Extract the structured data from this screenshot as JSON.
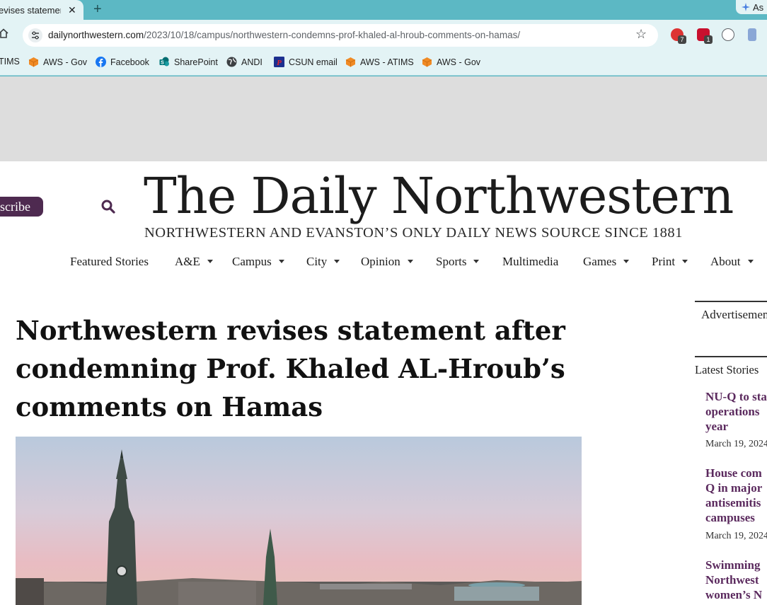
{
  "browser": {
    "tab_title": "evises statement",
    "new_tab_symbol": "+",
    "close_symbol": "✕",
    "ask_label": "As",
    "url_domain": "dailynorthwestern.com",
    "url_path": "/2023/10/18/campus/northwestern-condemns-prof-khaled-al-hroub-comments-on-hamas/",
    "extensions": [
      {
        "name": "adblock",
        "badge": "7",
        "color": "#c8102e"
      },
      {
        "name": "lock",
        "badge": "1",
        "color": "#c8102e"
      }
    ]
  },
  "bookmarks": [
    {
      "label": "TIMS",
      "icon": "none"
    },
    {
      "label": "AWS - Gov",
      "icon": "aws-cube-icon"
    },
    {
      "label": "Facebook",
      "icon": "facebook-icon"
    },
    {
      "label": "SharePoint",
      "icon": "sharepoint-icon"
    },
    {
      "label": "ANDI",
      "icon": "globe-icon"
    },
    {
      "label": "CSUN email",
      "icon": "csun-icon"
    },
    {
      "label": "AWS - ATIMS",
      "icon": "aws-cube-icon"
    },
    {
      "label": "AWS - Gov",
      "icon": "aws-cube-icon"
    }
  ],
  "site": {
    "subscribe_label": "scribe",
    "masthead": "The Daily Northwestern",
    "tagline": "NORTHWESTERN AND EVANSTON’S ONLY DAILY NEWS SOURCE SINCE 1881",
    "brand_color": "#4e2a50"
  },
  "nav": [
    {
      "label": "Featured Stories",
      "dropdown": false
    },
    {
      "label": "A&E",
      "dropdown": true
    },
    {
      "label": "Campus",
      "dropdown": true
    },
    {
      "label": "City",
      "dropdown": true
    },
    {
      "label": "Opinion",
      "dropdown": true
    },
    {
      "label": "Sports",
      "dropdown": true
    },
    {
      "label": "Multimedia",
      "dropdown": false
    },
    {
      "label": "Games",
      "dropdown": true
    },
    {
      "label": "Print",
      "dropdown": true
    },
    {
      "label": "About",
      "dropdown": true
    }
  ],
  "article": {
    "headline_lines": [
      "Northwestern revises statement after",
      "condemning Prof. Khaled AL-Hroub’s",
      "comments on Hamas"
    ]
  },
  "sidebar": {
    "ad_label": "Advertisement",
    "latest_title": "Latest Stories",
    "stories": [
      {
        "lines": [
          "NU-Q to sta",
          "operations",
          "year"
        ],
        "date": "March 19, 2024"
      },
      {
        "lines": [
          "House com",
          "Q in major",
          "antisemitis",
          "campuses"
        ],
        "date": "March 19, 2024"
      },
      {
        "lines": [
          "Swimming",
          "Northwest",
          "women’s N"
        ],
        "date": ""
      }
    ]
  }
}
